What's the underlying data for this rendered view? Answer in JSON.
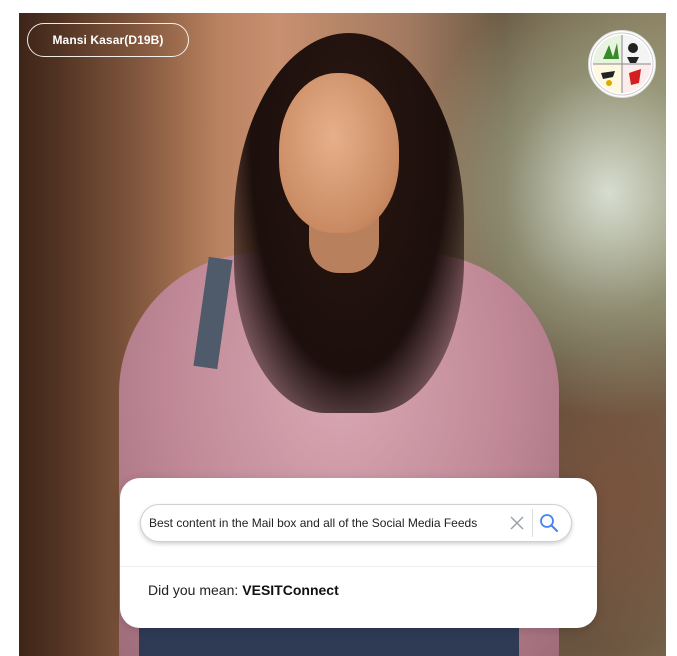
{
  "profile": {
    "name_tag": "Mansi Kasar(D19B)"
  },
  "logo": {
    "icon": "club-logo-icon"
  },
  "search": {
    "query": "Best content in the Mail box and all of the Social Media Feeds",
    "clear_icon": "close-icon",
    "search_icon": "search-icon"
  },
  "suggestion": {
    "prefix": "Did you mean:",
    "term": "VESITConnect"
  },
  "colors": {
    "accent": "#4285f4",
    "card_bg": "#ffffff",
    "text": "#222222"
  }
}
